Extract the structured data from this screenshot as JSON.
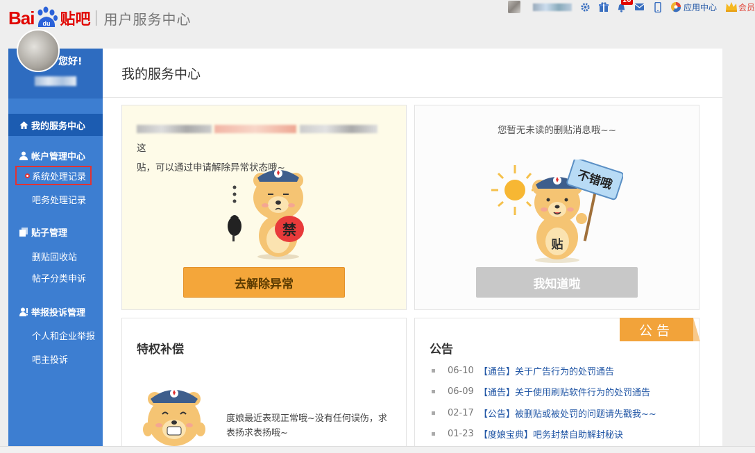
{
  "header": {
    "logo_bai": "Bai",
    "logo_du": "du",
    "logo_tieba": "贴吧",
    "subtitle": "用户服务中心",
    "badge_count": "10",
    "link_apps": "应用中心",
    "link_member": "会员"
  },
  "sidebar": {
    "greeting": "您好!",
    "active": "我的服务中心",
    "group_account": "帐户管理中心",
    "item_system_records": "系统处理记录",
    "item_bar_records": "吧务处理记录",
    "group_posts": "贴子管理",
    "item_recycle": "删贴回收站",
    "item_category_appeal": "帖子分类申诉",
    "group_report": "举报投诉管理",
    "item_report_personal": "个人和企业举报",
    "item_report_owner": "吧主投诉"
  },
  "main": {
    "title": "我的服务中心",
    "warning_tail": "这",
    "warning_line2": "贴，可以通过申请解除异常状态哦~",
    "warning_sign": "禁",
    "warning_button": "去解除异常",
    "no_msg": "您暂无未读的删贴消息哦~~",
    "ok_sign": "不错哦",
    "ok_belly": "贴",
    "ok_button": "我知道啦",
    "comp_title": "特权补偿",
    "comp_text": "度娘最近表现正常哦~没有任何误伤，求表扬求表扬哦~",
    "notice_title": "公告",
    "notice_tag": "公告",
    "notices": [
      {
        "date": "06-10",
        "text": "【通告】关于广告行为的处罚通告"
      },
      {
        "date": "06-09",
        "text": "【通告】关于使用刷贴软件行为的处罚通告"
      },
      {
        "date": "02-17",
        "text": "【公告】被删贴或被处罚的问题请先戳我~~"
      },
      {
        "date": "01-23",
        "text": "【度娘宝典】吧务封禁自助解封秘诀"
      }
    ]
  },
  "colors": {
    "brand_red": "#e10601",
    "sidebar_blue": "#3d7ed1",
    "link_blue": "#2156a5",
    "orange": "#f4a63a"
  }
}
